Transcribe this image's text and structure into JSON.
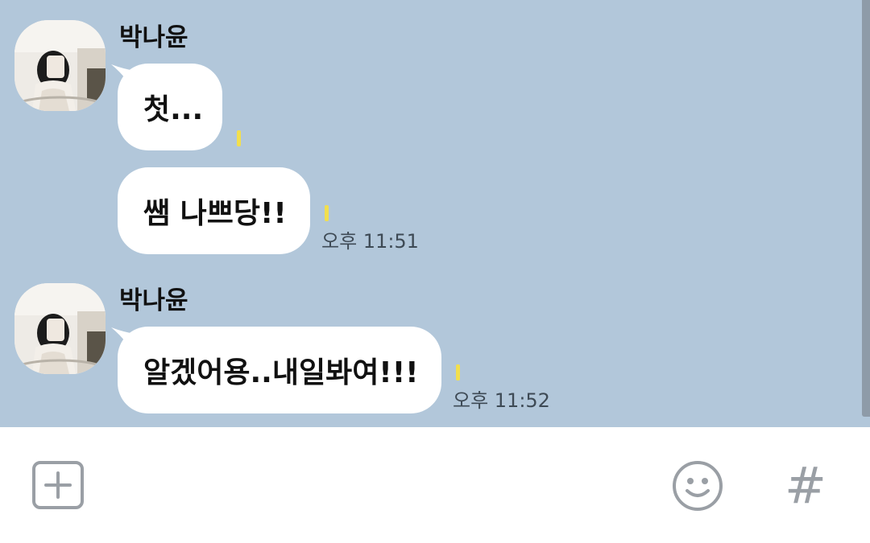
{
  "messages": [
    {
      "sender": "박나윤",
      "bubbles": [
        {
          "text": "첫...",
          "read_mark": "1",
          "time": ""
        },
        {
          "text": "쌤 나쁘당!!",
          "read_mark": "1",
          "time": "오후 11:51"
        }
      ]
    },
    {
      "sender": "박나윤",
      "bubbles": [
        {
          "text": "알겠어용..내일봐여!!!",
          "read_mark": "1",
          "time": "오후 11:52"
        }
      ]
    }
  ],
  "input_bar": {
    "add_icon": "plus-square-icon",
    "emoji_icon": "smiley-icon",
    "hash_icon": "#"
  },
  "colors": {
    "chat_background": "#b2c7da",
    "bubble": "#ffffff",
    "read_mark": "#f2df4e",
    "input_background": "#ffffff",
    "icon_gray": "#9a9fa5"
  }
}
